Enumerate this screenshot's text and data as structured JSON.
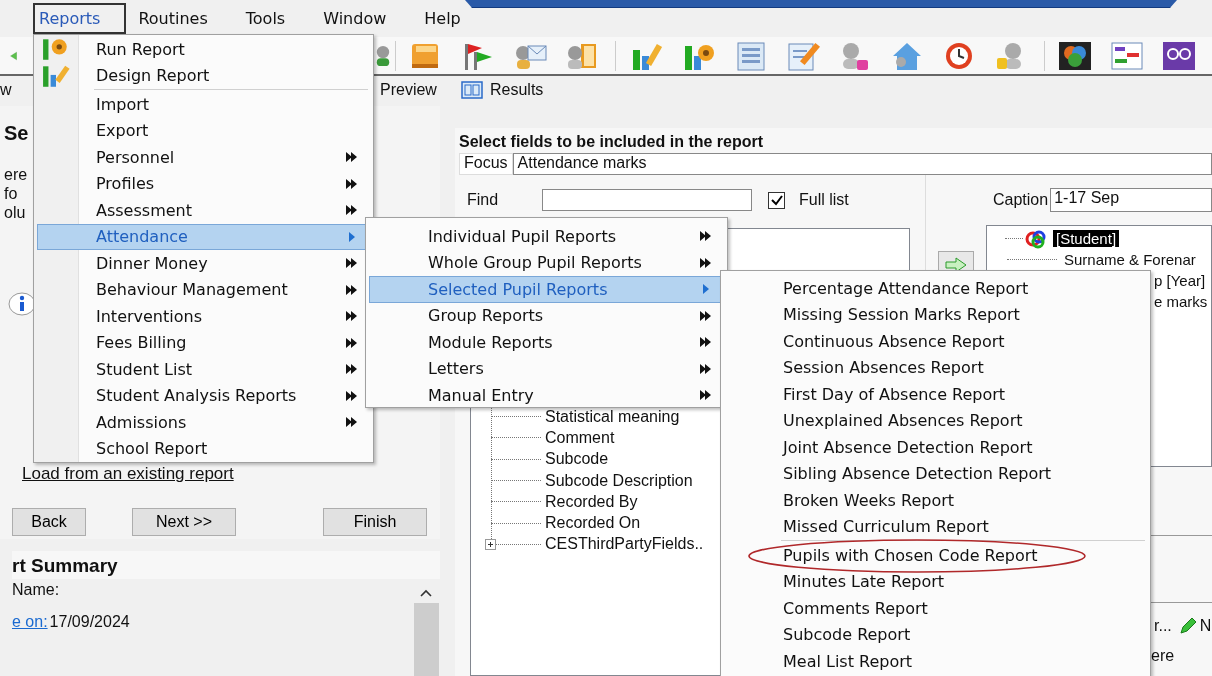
{
  "menu_bar": [
    {
      "label": "Reports",
      "selected": true
    },
    {
      "label": "Routines",
      "selected": false
    },
    {
      "label": "Tools",
      "selected": false
    },
    {
      "label": "Window",
      "selected": false
    },
    {
      "label": "Help",
      "selected": false
    }
  ],
  "view_bar": [
    {
      "label": "w",
      "icon": false
    },
    {
      "label": "Preview",
      "icon": false
    },
    {
      "label": "Results",
      "icon": true
    }
  ],
  "left_panel": {
    "heading": "Se",
    "lines": [
      "ere",
      "fo",
      "olu"
    ],
    "link": "Load from an existing report",
    "buttons": [
      "Back",
      "Next >>",
      "Finish"
    ]
  },
  "summary": {
    "title": "rt Summary",
    "name_label": "Name:",
    "date_link": "e on:",
    "date": "17/09/2024"
  },
  "field_panel": {
    "title": "Select fields to be included in the report",
    "focus_label": "Focus",
    "focus_value": "Attendance marks",
    "find_label": "Find",
    "full_list": {
      "label": "Full list",
      "checked": true
    },
    "fields": [
      {
        "label": "Statistical meaning",
        "expandable": false
      },
      {
        "label": "Comment",
        "expandable": false
      },
      {
        "label": "Subcode",
        "expandable": false
      },
      {
        "label": "Subcode Description",
        "expandable": false
      },
      {
        "label": "Recorded By",
        "expandable": false
      },
      {
        "label": "Recorded On",
        "expandable": false
      },
      {
        "label": "CESThirdPartyFields..",
        "expandable": true
      }
    ],
    "caption_label": "Caption",
    "caption_value": "1-17 Sep",
    "chosen": [
      {
        "label": "[Student]",
        "kind": "root",
        "selected": true
      },
      {
        "label": "Surname & Forenar",
        "kind": "field",
        "selected": false
      },
      {
        "label": "p [Year]",
        "kind": "cut",
        "selected": false
      },
      {
        "label": "e marks",
        "kind": "cut",
        "selected": false
      }
    ],
    "bottom": {
      "text": "r...",
      "button": "N",
      "note": "ere"
    }
  },
  "menus": [
    {
      "items": [
        {
          "label": "Run Report",
          "submenu": false,
          "selected": false
        },
        {
          "label": "Design Report",
          "submenu": false,
          "selected": false,
          "separator_after": true
        },
        {
          "label": "Import",
          "submenu": false,
          "selected": false
        },
        {
          "label": "Export",
          "submenu": false,
          "selected": false
        },
        {
          "label": "Personnel",
          "submenu": true,
          "selected": false
        },
        {
          "label": "Profiles",
          "submenu": true,
          "selected": false
        },
        {
          "label": "Assessment",
          "submenu": true,
          "selected": false
        },
        {
          "label": "Attendance",
          "submenu": true,
          "selected": true
        },
        {
          "label": "Dinner Money",
          "submenu": true,
          "selected": false
        },
        {
          "label": "Behaviour Management",
          "submenu": true,
          "selected": false
        },
        {
          "label": "Interventions",
          "submenu": true,
          "selected": false
        },
        {
          "label": "Fees Billing",
          "submenu": true,
          "selected": false
        },
        {
          "label": "Student List",
          "submenu": true,
          "selected": false
        },
        {
          "label": "Student Analysis Reports",
          "submenu": true,
          "selected": false
        },
        {
          "label": "Admissions",
          "submenu": true,
          "selected": false
        },
        {
          "label": "School Report",
          "submenu": false,
          "selected": false
        }
      ]
    },
    {
      "items": [
        {
          "label": "Individual Pupil Reports",
          "submenu": true,
          "selected": false
        },
        {
          "label": "Whole Group Pupil Reports",
          "submenu": true,
          "selected": false
        },
        {
          "label": "Selected Pupil Reports",
          "submenu": true,
          "selected": true
        },
        {
          "label": "Group Reports",
          "submenu": true,
          "selected": false
        },
        {
          "label": "Module Reports",
          "submenu": true,
          "selected": false
        },
        {
          "label": "Letters",
          "submenu": true,
          "selected": false
        },
        {
          "label": "Manual Entry",
          "submenu": true,
          "selected": false
        }
      ]
    },
    {
      "items": [
        {
          "label": "Percentage Attendance Report",
          "submenu": false,
          "selected": false
        },
        {
          "label": "Missing Session Marks Report",
          "submenu": false,
          "selected": false
        },
        {
          "label": "Continuous Absence Report",
          "submenu": false,
          "selected": false
        },
        {
          "label": "Session Absences Report",
          "submenu": false,
          "selected": false
        },
        {
          "label": "First Day of Absence Report",
          "submenu": false,
          "selected": false
        },
        {
          "label": "Unexplained Absences Report",
          "submenu": false,
          "selected": false
        },
        {
          "label": "Joint Absence Detection Report",
          "submenu": false,
          "selected": false
        },
        {
          "label": "Sibling Absence Detection Report",
          "submenu": false,
          "selected": false
        },
        {
          "label": "Broken Weeks Report",
          "submenu": false,
          "selected": false
        },
        {
          "label": "Missed Curriculum Report",
          "submenu": false,
          "selected": false,
          "separator_after": true
        },
        {
          "label": "Pupils with Chosen Code Report",
          "submenu": false,
          "selected": false,
          "circled": true
        },
        {
          "label": "Minutes Late Report",
          "submenu": false,
          "selected": false
        },
        {
          "label": "Comments Report",
          "submenu": false,
          "selected": false
        },
        {
          "label": "Subcode Report",
          "submenu": false,
          "selected": false
        },
        {
          "label": "Meal List Report",
          "submenu": false,
          "selected": false
        }
      ]
    }
  ]
}
